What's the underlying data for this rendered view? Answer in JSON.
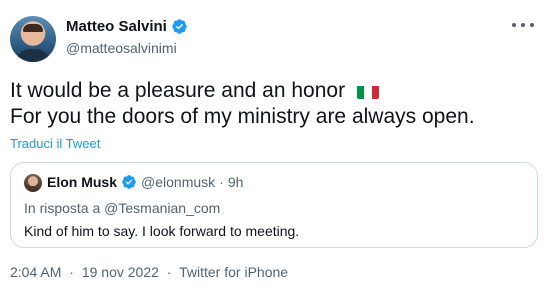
{
  "author": {
    "display_name": "Matteo Salvini",
    "handle": "@matteosalvinimi",
    "verified": true
  },
  "tweet": {
    "line1": "It would be a pleasure and an honor",
    "flag": "italy-flag",
    "line2": "For you the doors of my ministry are always open.",
    "translate_label": "Traduci il Tweet"
  },
  "quoted": {
    "display_name": "Elon Musk",
    "handle": "@elonmusk",
    "dot": "·",
    "time": "9h",
    "reply_prefix": "In risposta a",
    "reply_to": "@Tesmanian_com",
    "text": "Kind of him to say. I look forward to meeting."
  },
  "meta": {
    "time": "2:04 AM",
    "sep": "·",
    "date": "19 nov 2022",
    "source": "Twitter for iPhone"
  },
  "colors": {
    "link": "#1d9bf0",
    "secondary_text": "#536471",
    "primary_text": "#0f1419",
    "border": "#cfd9de",
    "verified": "#1d9bf0"
  },
  "icons": [
    "verified-badge-icon",
    "more-options-icon",
    "italy-flag-icon"
  ]
}
